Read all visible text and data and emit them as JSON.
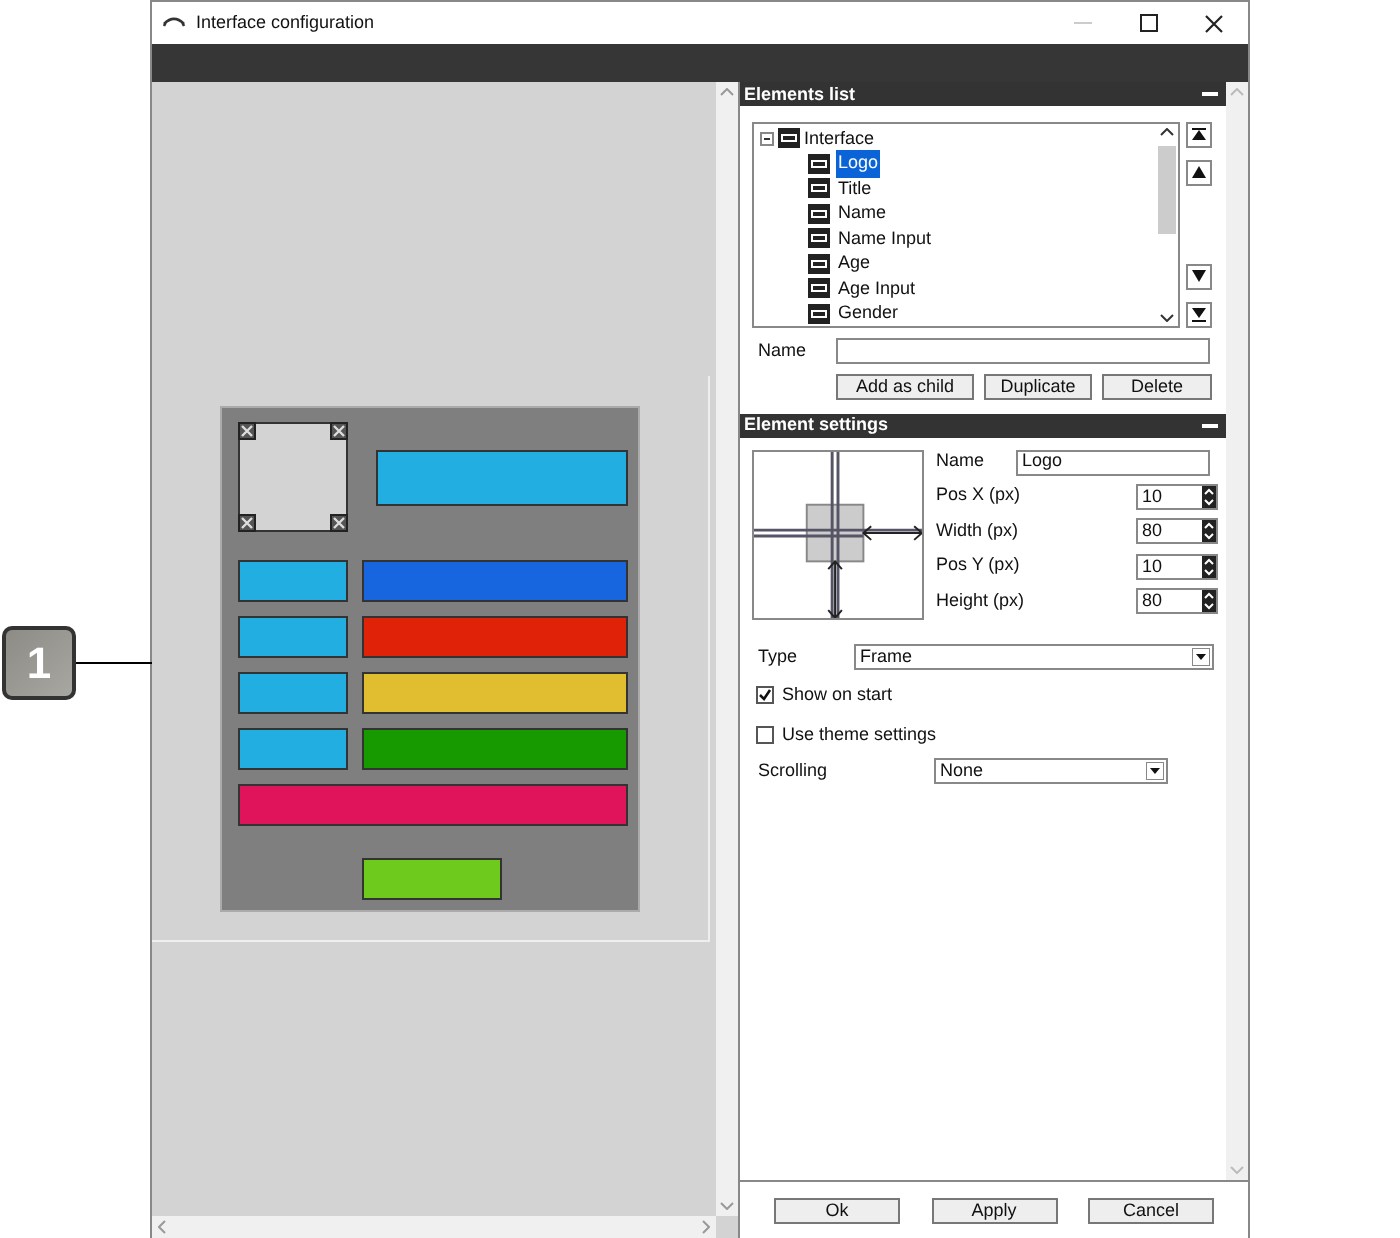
{
  "window": {
    "title": "Interface configuration"
  },
  "callout": {
    "label": "1"
  },
  "canvas": {
    "elements": [
      {
        "kind": "frame",
        "color": "#d3d3d3"
      },
      {
        "kind": "bar",
        "color": "#22aee0"
      },
      {
        "kind": "bar",
        "color": "#22aee0"
      },
      {
        "kind": "bar",
        "color": "#1766e0"
      },
      {
        "kind": "bar",
        "color": "#22aee0"
      },
      {
        "kind": "bar",
        "color": "#e02208"
      },
      {
        "kind": "bar",
        "color": "#22aee0"
      },
      {
        "kind": "bar",
        "color": "#e0be30"
      },
      {
        "kind": "bar",
        "color": "#22aee0"
      },
      {
        "kind": "bar",
        "color": "#179a00"
      },
      {
        "kind": "bar",
        "color": "#e0145a"
      },
      {
        "kind": "bar",
        "color": "#6ecb1e"
      }
    ]
  },
  "elements_list": {
    "title": "Elements list",
    "tree": {
      "label": "Interface",
      "expanded": true,
      "selected": false,
      "children": [
        {
          "label": "Logo",
          "selected": true
        },
        {
          "label": "Title",
          "selected": false
        },
        {
          "label": "Name",
          "selected": false
        },
        {
          "label": "Name Input",
          "selected": false
        },
        {
          "label": "Age",
          "selected": false
        },
        {
          "label": "Age Input",
          "selected": false
        },
        {
          "label": "Gender",
          "selected": false
        }
      ]
    },
    "name_label": "Name",
    "buttons": [
      "Add as child",
      "Duplicate",
      "Delete"
    ]
  },
  "element_settings": {
    "title": "Element settings",
    "name": {
      "label": "Name",
      "value": "Logo"
    },
    "fields": [
      {
        "label": "Pos X (px)",
        "value": "10"
      },
      {
        "label": "Width (px)",
        "value": "80"
      },
      {
        "label": "Pos Y (px)",
        "value": "10"
      },
      {
        "label": "Height (px)",
        "value": "80"
      }
    ],
    "type": {
      "label": "Type",
      "value": "Frame"
    },
    "checkboxes": [
      {
        "label": "Show on start",
        "checked": true
      },
      {
        "label": "Use theme settings",
        "checked": false
      }
    ],
    "scrolling": {
      "label": "Scrolling",
      "value": "None"
    }
  },
  "footer_buttons": [
    "Ok",
    "Apply",
    "Cancel"
  ]
}
